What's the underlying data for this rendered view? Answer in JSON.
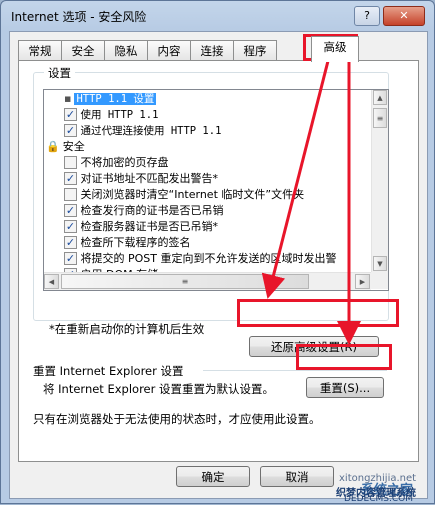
{
  "window": {
    "title": "Internet 选项 - 安全风险",
    "help_label": "?",
    "close_label": "✕"
  },
  "tabs": [
    "常规",
    "安全",
    "隐私",
    "内容",
    "连接",
    "程序",
    "高级"
  ],
  "settings_group": {
    "label": "设置"
  },
  "settings_items": [
    {
      "text": "HTTP 1.1 设置",
      "kind": "header",
      "mono": true
    },
    {
      "text": "使用 HTTP 1.1",
      "kind": "checkbox",
      "checked": true,
      "mono": true
    },
    {
      "text": "通过代理连接使用 HTTP 1.1",
      "kind": "checkbox",
      "checked": true,
      "mono": true
    },
    {
      "text": "安全",
      "kind": "category",
      "icon": "lock-icon"
    },
    {
      "text": "不将加密的页存盘",
      "kind": "checkbox",
      "checked": false
    },
    {
      "text": "对证书地址不匹配发出警告*",
      "kind": "checkbox",
      "checked": true
    },
    {
      "text": "关闭浏览器时清空“Internet 临时文件”文件夹",
      "kind": "checkbox",
      "checked": false
    },
    {
      "text": "检查发行商的证书是否已吊销",
      "kind": "checkbox",
      "checked": true
    },
    {
      "text": "检查服务器证书是否已吊销*",
      "kind": "checkbox",
      "checked": true
    },
    {
      "text": "检查所下载程序的签名",
      "kind": "checkbox",
      "checked": true
    },
    {
      "text": "将提交的 POST 重定向到不允许发送的区域时发出警",
      "kind": "checkbox",
      "checked": true
    },
    {
      "text": "启用 DOM 存储",
      "kind": "checkbox",
      "checked": true
    }
  ],
  "restart_note": "*在重新启动你的计算机后生效",
  "restore_advanced_label": "还原高级设置(R)",
  "reset_group": {
    "label": "重置 Internet Explorer 设置",
    "description": "将 Internet Explorer 设置重置为默认设置。",
    "reset_button_label": "重置(S)...",
    "warning": "只有在浏览器处于无法使用的状态时，才应使用此设置。"
  },
  "footer": {
    "ok_label": "确定",
    "cancel_label": "取消"
  },
  "watermark": {
    "line1": "系统之家",
    "line2": "xitongzhijia.net",
    "line3": "织梦内容管理系统",
    "line4": "DEDECMS.COM"
  },
  "colors": {
    "annotation_red": "#e8152a",
    "selection_blue": "#3399ff"
  }
}
